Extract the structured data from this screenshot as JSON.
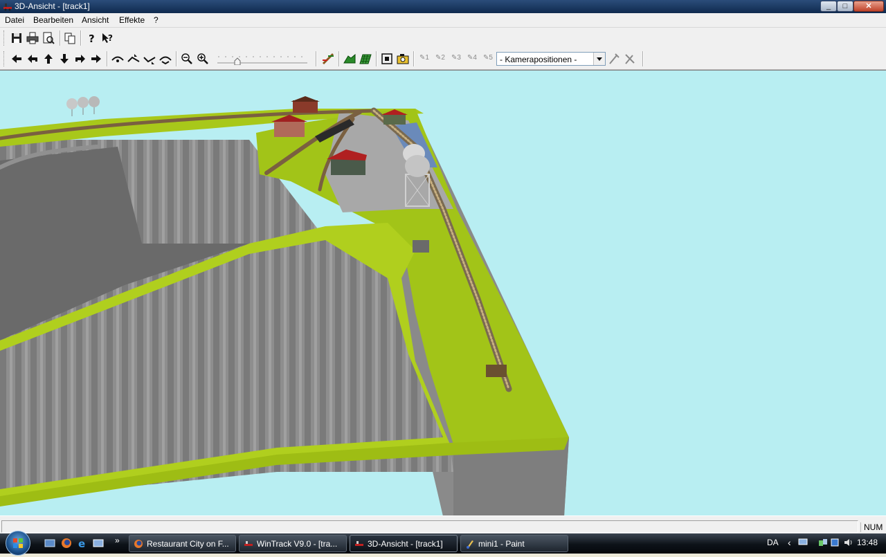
{
  "window": {
    "title": "3D-Ansicht - [track1]"
  },
  "window_controls": {
    "minimize": "_",
    "maximize": "□",
    "close": "✕"
  },
  "menu": [
    "Datei",
    "Bearbeiten",
    "Ansicht",
    "Effekte",
    "?"
  ],
  "toolbar1": {
    "icons": [
      "save-icon",
      "print-icon",
      "print-preview-icon",
      "copy-icon",
      "help-icon",
      "context-help-icon"
    ]
  },
  "toolbar2": {
    "nav_icons": [
      "arrow-left-icon",
      "arrow-turn-left-icon",
      "arrow-up-icon",
      "arrow-down-icon",
      "arrow-turn-right-icon",
      "arrow-right-icon"
    ],
    "walk_icons": [
      "walk-up-icon",
      "walk-left-icon",
      "walk-down-icon",
      "walk-right-icon"
    ],
    "zoom_icons": [
      "zoom-out-icon",
      "zoom-in-icon"
    ],
    "camera_positions": [
      "1",
      "2",
      "3",
      "4",
      "5"
    ],
    "camera_select": {
      "value": "- Kamerapositionen -"
    }
  },
  "statusbar": {
    "num": "NUM"
  },
  "taskbar": {
    "tasks": [
      {
        "label": "Restaurant City on F..."
      },
      {
        "label": "WinTrack  V9.0 - [tra..."
      },
      {
        "label": "3D-Ansicht - [track1]"
      },
      {
        "label": "mini1 - Paint"
      }
    ],
    "chevron": "»",
    "lang": "DA",
    "tray_chevron": "‹",
    "clock": "13:48"
  },
  "colors": {
    "sky": "#b8eef2",
    "grass": "#a8c81a",
    "rock": "#8c8c8c"
  }
}
